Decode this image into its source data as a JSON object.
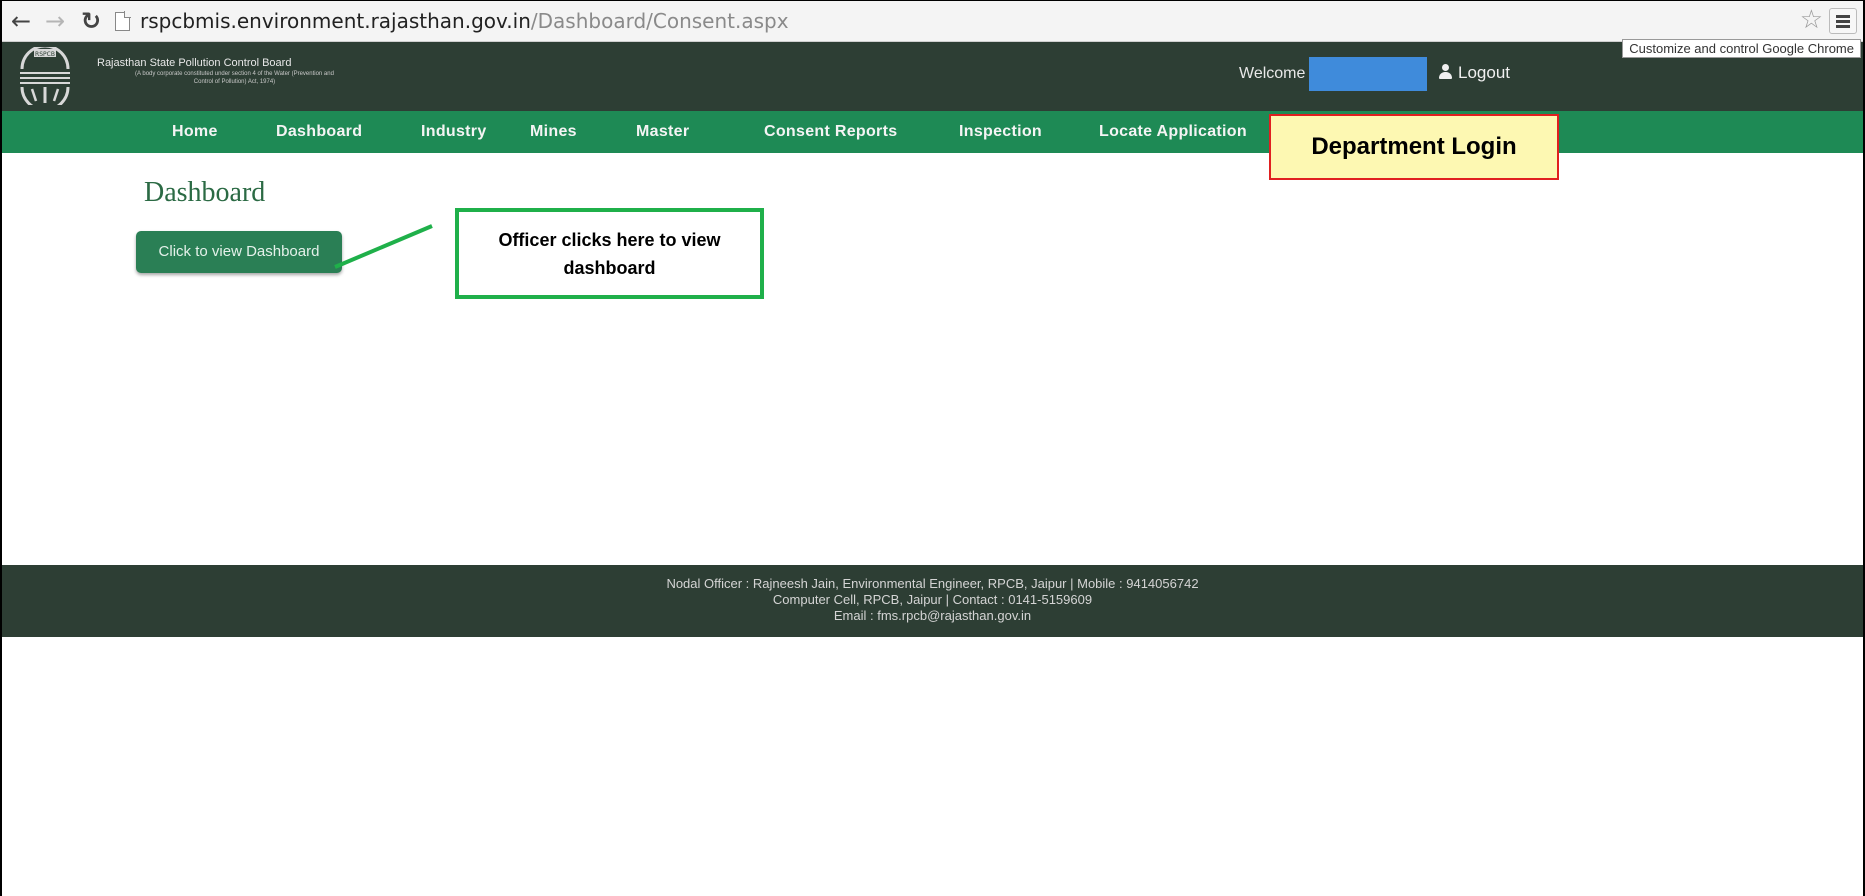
{
  "browser": {
    "url_host": "rspcbmis.environment.rajasthan.gov.in",
    "url_path": "/Dashboard/Consent.aspx",
    "menu_tooltip": "Customize and control Google Chrome",
    "icons": {
      "back": "back-arrow-icon",
      "forward": "forward-arrow-icon",
      "reload": "reload-icon",
      "page": "page-icon",
      "bookmark": "star-icon",
      "menu": "hamburger-menu-icon"
    }
  },
  "header": {
    "logo_text": "RSPCB",
    "org_name": "Rajasthan State Pollution Control Board",
    "org_subtitle": "(A body corporate constituted under section 4 of the Water (Prevention and Control of Pollution) Act, 1974)",
    "welcome_label": "Welcome",
    "user_name": "",
    "logout_label": "Logout",
    "logout_icon": "user-icon",
    "user_box_color": "#3f8bdb"
  },
  "nav": {
    "items": [
      {
        "label": "Home"
      },
      {
        "label": "Dashboard"
      },
      {
        "label": "Industry"
      },
      {
        "label": "Mines"
      },
      {
        "label": "Master"
      },
      {
        "label": "Consent Reports"
      },
      {
        "label": "Inspection"
      },
      {
        "label": "Locate Application"
      }
    ],
    "background": "#1e8a55"
  },
  "annotations": {
    "department_login": "Department Login",
    "officer_note": "Officer clicks here to view dashboard"
  },
  "main": {
    "title": "Dashboard",
    "view_button_label": "Click to view Dashboard"
  },
  "footer": {
    "line1": "Nodal Officer : Rajneesh Jain, Environmental Engineer, RPCB, Jaipur | Mobile : 9414056742",
    "line2": "Computer Cell, RPCB, Jaipur | Contact : 0141-5159609",
    "line3": "Email : fms.rpcb@rajasthan.gov.in"
  },
  "colors": {
    "header_bg": "#2d3e34",
    "accent_green": "#2a7f55",
    "callout_border": "#1fb04a",
    "login_callout_border": "#e02020",
    "login_callout_bg": "#fdf8b2"
  }
}
